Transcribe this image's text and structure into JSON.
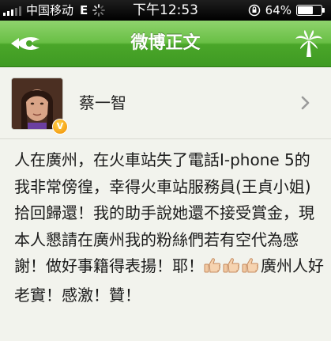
{
  "status_bar": {
    "carrier": "中国移动",
    "network": "E",
    "time": "下午12:53",
    "battery": "64%",
    "battery_level": 0.64
  },
  "nav": {
    "title": "微博正文",
    "back_icon": "eye-back-icon",
    "right_icon": "palm-tree-icon"
  },
  "author": {
    "name": "蔡一智",
    "badge": "V"
  },
  "post": {
    "text": "人在廣州，在火車站失了電話I-phone 5的我非常傍徨，幸得火車站服務員(王貞小姐)拾回歸還！我的助手說她還不接受賞金，現本人懇請在廣州我的粉絲們若有空代為感謝！做好事籍得表揚！耶！",
    "tail": "廣州人好老實！感激！贊！",
    "emoji": [
      "thumbs-up-icon",
      "thumbs-up-icon",
      "thumbs-up-icon"
    ]
  },
  "colors": {
    "nav_green": "#4aa629",
    "background": "#f2f3ed"
  }
}
